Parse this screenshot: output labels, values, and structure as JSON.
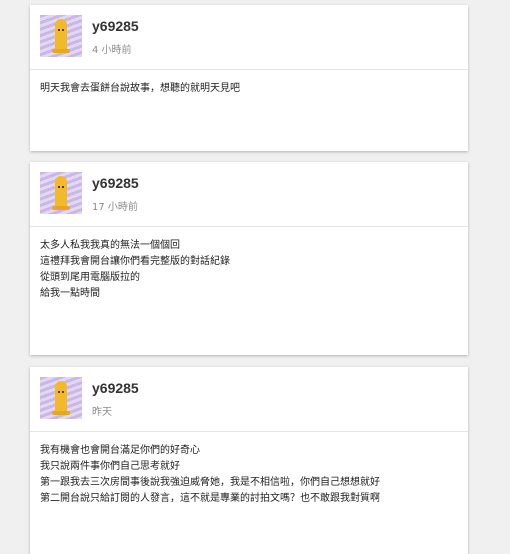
{
  "posts": [
    {
      "username": "y69285",
      "timestamp": "4 小時前",
      "lines": [
        "明天我會去蛋餅台說故事，想聽的就明天見吧"
      ]
    },
    {
      "username": "y69285",
      "timestamp": "17 小時前",
      "lines": [
        "太多人私我我真的無法一個個回",
        "這禮拜我會開台讓你們看完整版的對話紀錄",
        "從頭到尾用電腦版拉的",
        "給我一點時間"
      ]
    },
    {
      "username": "y69285",
      "timestamp": "昨天",
      "lines": [
        "我有機會也會開台滿足你們的好奇心",
        "我只說兩件事你們自己思考就好",
        "第一跟我去三次房間事後說我強迫威脅她，我是不相信啦，你們自己想想就好",
        "第二開台說只給訂閱的人發言，這不就是專業的討拍文嗎？也不敢跟我對質啊"
      ]
    }
  ],
  "colors": {
    "background": "#f0f0f0",
    "card": "#ffffff",
    "avatar_stripe_light": "#e3d8f3",
    "avatar_stripe_dark": "#c9b8e6",
    "avatar_figure": "#f2b928"
  },
  "icons": {
    "avatar": "yellow-figure-avatar"
  }
}
